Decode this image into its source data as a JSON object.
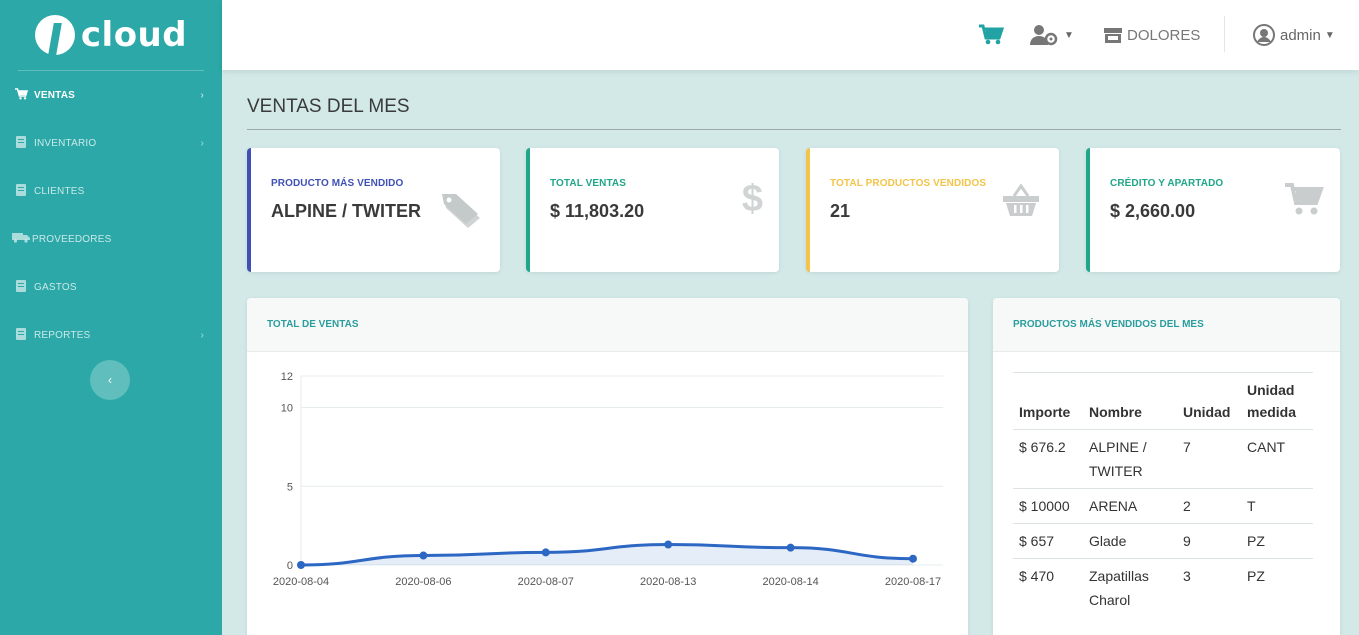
{
  "brand": {
    "name": "cloud"
  },
  "sidebar": {
    "items": [
      {
        "label": "VENTAS",
        "icon": "cart-icon",
        "active": true,
        "has_arrow": true
      },
      {
        "label": "INVENTARIO",
        "icon": "clipboard-icon",
        "active": false,
        "has_arrow": true
      },
      {
        "label": "CLIENTES",
        "icon": "address-book-icon",
        "active": false,
        "has_arrow": false
      },
      {
        "label": "PROVEEDORES",
        "icon": "truck-icon",
        "active": false,
        "has_arrow": false
      },
      {
        "label": "GASTOS",
        "icon": "file-icon",
        "active": false,
        "has_arrow": false
      },
      {
        "label": "REPORTES",
        "icon": "clipboard-icon",
        "active": false,
        "has_arrow": true
      }
    ],
    "collapse_glyph": "‹"
  },
  "topbar": {
    "store_label": "DOLORES",
    "user_label": "admin"
  },
  "page": {
    "title": "VENTAS DEL MES"
  },
  "cards": [
    {
      "label": "PRODUCTO MÁS VENDIDO",
      "value": "ALPINE / TWITER",
      "accent": "#3f51b5",
      "label_color": "#3f51b5",
      "icon": "tags-icon"
    },
    {
      "label": "TOTAL VENTAS",
      "value": "$ 11,803.20",
      "accent": "#20a688",
      "label_color": "#20a688",
      "icon": "dollar-icon"
    },
    {
      "label": "TOTAL PRODUCTOS VENDIDOS",
      "value": "21",
      "accent": "#f3c44b",
      "label_color": "#f3c44b",
      "icon": "basket-icon"
    },
    {
      "label": "CRÉDITO Y APARTADO",
      "value": "$ 2,660.00",
      "accent": "#20a688",
      "label_color": "#20a688",
      "icon": "cart-icon"
    }
  ],
  "chart_panel": {
    "title": "TOTAL DE VENTAS"
  },
  "chart_data": {
    "type": "line",
    "x": [
      "2020-08-04",
      "2020-08-06",
      "2020-08-07",
      "2020-08-13",
      "2020-08-14",
      "2020-08-17"
    ],
    "series": [
      {
        "values": [
          0,
          0.6,
          0.8,
          1.3,
          1.1,
          0.4
        ],
        "color": "#2d67c4"
      }
    ],
    "yticks": [
      0,
      5,
      10,
      12
    ],
    "ylim": [
      0,
      12
    ],
    "grid": true
  },
  "table_panel": {
    "title": "PRODUCTOS MÁS VENDIDOS DEL MES",
    "columns": [
      "Importe",
      "Nombre",
      "Unidad",
      "Unidad medida"
    ],
    "rows": [
      [
        "$ 676.2",
        "ALPINE / TWITER",
        "7",
        "CANT"
      ],
      [
        "$ 10000",
        "ARENA",
        "2",
        "T"
      ],
      [
        "$ 657",
        "Glade",
        "9",
        "PZ"
      ],
      [
        "$ 470",
        "Zapatillas Charol",
        "3",
        "PZ"
      ]
    ]
  }
}
